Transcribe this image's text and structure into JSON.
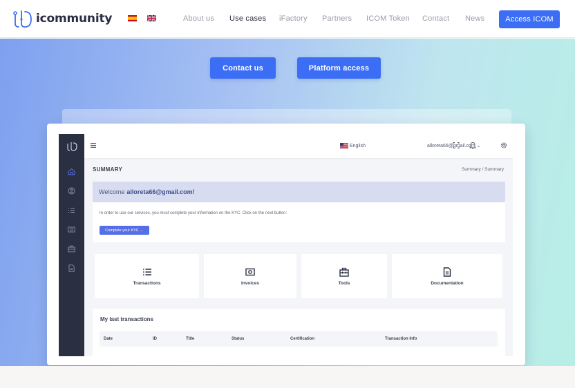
{
  "header": {
    "brand": "icommunity",
    "nav": [
      {
        "label": "About us",
        "active": false
      },
      {
        "label": "Use cases",
        "active": true
      },
      {
        "label": "iFactory",
        "active": false
      },
      {
        "label": "Partners",
        "active": false
      },
      {
        "label": "ICOM Token",
        "active": false
      },
      {
        "label": "Contact",
        "active": false
      },
      {
        "label": "News",
        "active": false
      }
    ],
    "access_button": "Access ICOM",
    "languages": [
      "es-flag-icon",
      "uk-flag-icon"
    ]
  },
  "hero": {
    "contact_button": "Contact us",
    "platform_button": "Platform access"
  },
  "dashboard": {
    "topbar": {
      "language": "English",
      "user": "alloreta66@gmail.com ⌄"
    },
    "page_title": "SUMMARY",
    "breadcrumb": "Summary  /  Summary",
    "welcome_prefix": "Welcome",
    "welcome_user": "alloreta66@gmail.com!",
    "kyc_text": "In order to use our services, you must complete your information on the KYC. Click on the next button:",
    "kyc_button": "Complete your KYC  →",
    "tiles": [
      {
        "label": "Transactions",
        "icon": "list-icon"
      },
      {
        "label": "Invoices",
        "icon": "invoice-icon"
      },
      {
        "label": "Tools",
        "icon": "toolbox-icon"
      },
      {
        "label": "Documentation",
        "icon": "document-icon"
      }
    ],
    "transactions": {
      "title": "My last transactions",
      "columns": [
        "Date",
        "ID",
        "Title",
        "Status",
        "Certification",
        "Transaction Info"
      ]
    }
  },
  "colors": {
    "accent": "#3b6ef5",
    "sidebar": "#2a3042",
    "welcome_bg": "#d7dcf0",
    "kyc_button": "#556ee6"
  }
}
